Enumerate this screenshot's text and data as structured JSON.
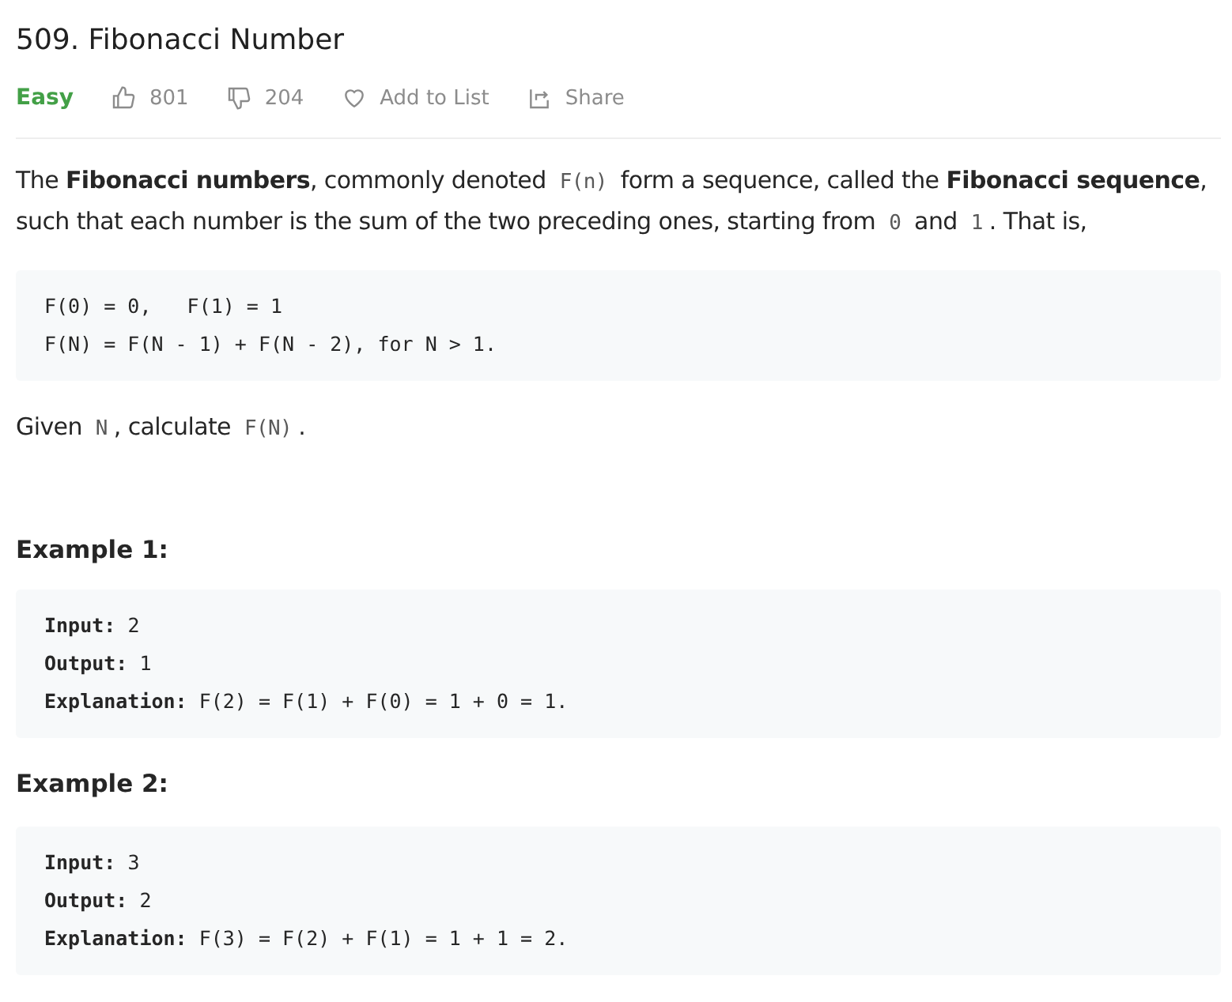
{
  "title": "509. Fibonacci Number",
  "meta": {
    "difficulty": "Easy",
    "likes": "801",
    "dislikes": "204",
    "add_to_list": "Add to List",
    "share": "Share"
  },
  "intro": [
    {
      "kind": "text",
      "text": "The **Fibonacci numbers**, commonly denoted "
    },
    {
      "kind": "code",
      "text": "F(n)"
    },
    {
      "kind": "text",
      "text": " form a sequence, called the **Fibonacci sequence**, such that each number is the sum of the two preceding ones, starting from "
    },
    {
      "kind": "code",
      "text": "0"
    },
    {
      "kind": "text",
      "text": " and "
    },
    {
      "kind": "code",
      "text": "1"
    },
    {
      "kind": "text",
      "text": ". That is,"
    }
  ],
  "definition": [
    "F(0) = 0,   F(1) = 1",
    "F(N) = F(N - 1) + F(N - 2), for N > 1."
  ],
  "task": [
    {
      "kind": "text",
      "text": "Given "
    },
    {
      "kind": "code",
      "text": "N"
    },
    {
      "kind": "text",
      "text": ", calculate "
    },
    {
      "kind": "code",
      "text": "F(N)"
    },
    {
      "kind": "text",
      "text": "."
    }
  ],
  "examples": [
    {
      "heading": "Example 1:",
      "lines": [
        {
          "label": "Input:",
          "value": "2"
        },
        {
          "label": "Output:",
          "value": "1"
        },
        {
          "label": "Explanation:",
          "value": "F(2) = F(1) + F(0) = 1 + 0 = 1."
        }
      ]
    },
    {
      "heading": "Example 2:",
      "lines": [
        {
          "label": "Input:",
          "value": "3"
        },
        {
          "label": "Output:",
          "value": "2"
        },
        {
          "label": "Explanation:",
          "value": "F(3) = F(2) + F(1) = 1 + 1 = 2."
        }
      ]
    }
  ]
}
